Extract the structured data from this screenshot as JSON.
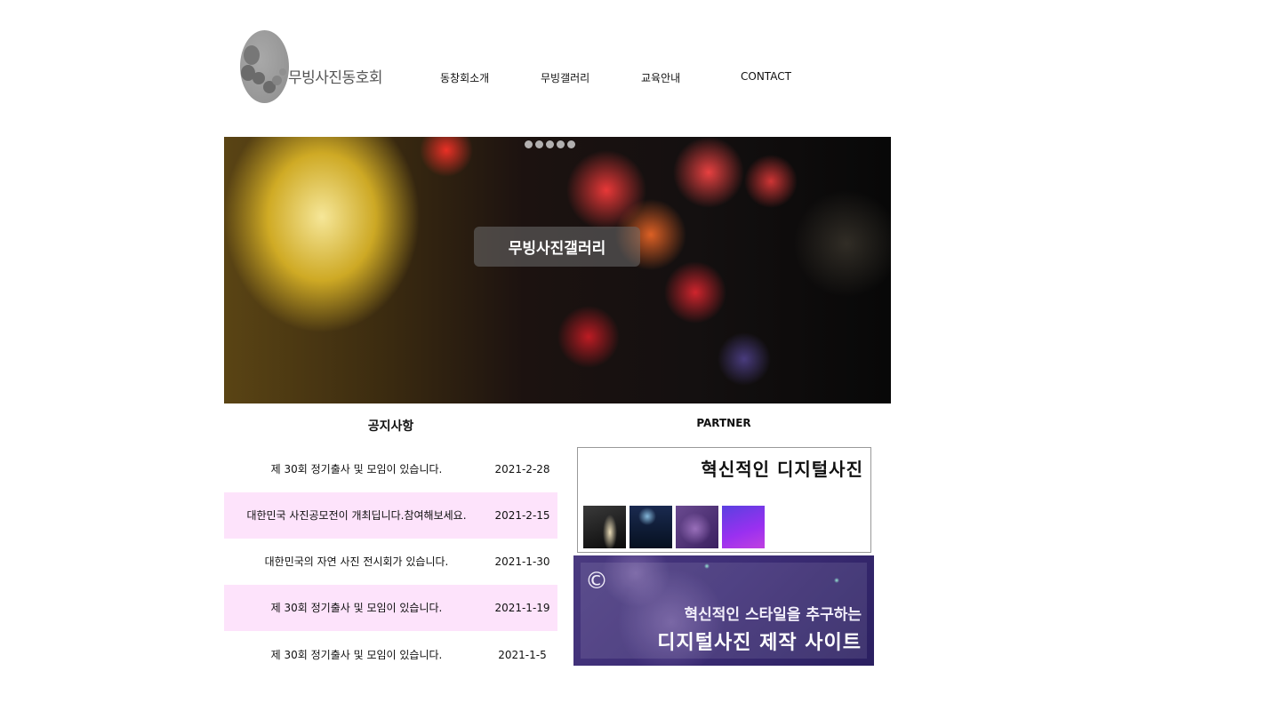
{
  "header": {
    "logo_text": "무빙사진동호회",
    "nav": [
      "동창회소개",
      "무빙갤러리",
      "교육안내",
      "CONTACT"
    ]
  },
  "hero": {
    "title": "무빙사진갤러리",
    "slide_count": 5
  },
  "notices": {
    "title": "공지사항",
    "items": [
      {
        "text": "제 30회 정기출사 및 모임이 있습니다.",
        "date": "2021-2-28"
      },
      {
        "text": "대한민국 사진공모전이 개최딥니다.참여해보세요.",
        "date": "2021-2-15"
      },
      {
        "text": "대한민국의 자연 사진 전시회가 있습니다.",
        "date": "2021-1-30"
      },
      {
        "text": "제 30회 정기출사 및 모임이 있습니다.",
        "date": "2021-1-19"
      },
      {
        "text": "제 30회 정기출사 및 모임이 있습니다.",
        "date": "2021-1-5"
      }
    ]
  },
  "partner": {
    "title": "PARTNER",
    "banner1_text": "혁신적인 디지털사진",
    "banner2_symbol": "©",
    "banner2_sub": "혁신적인 스타일을 추구하는",
    "banner2_main": "디지털사진 제작 사이트"
  },
  "colors": {
    "notice_highlight": "#fde3fb",
    "banner_purple": "#3d2d76"
  }
}
